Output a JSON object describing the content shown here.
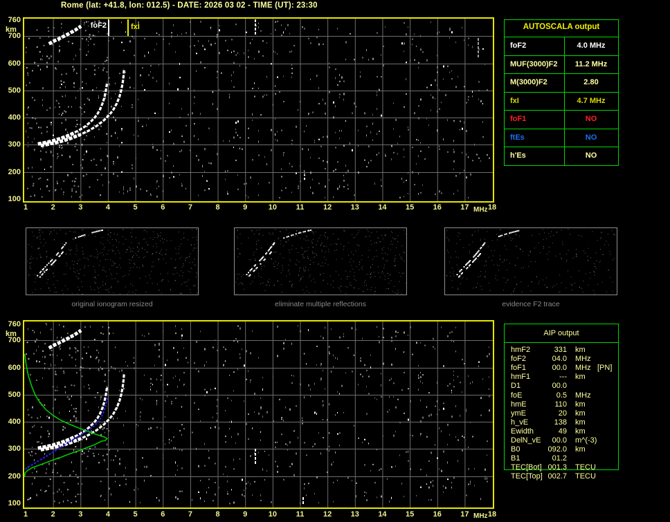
{
  "title": "Rome (lat: +41.8, lon: 012.5) - DATE: 2026 03 02 - TIME (UT): 23:30",
  "colors": {
    "pale_yellow": "#ffff9e",
    "bright_yellow": "#f0f000",
    "value_yellow": "#d8d800",
    "white": "#ffffff",
    "red": "#ff2020",
    "blue": "#1a70f0",
    "table_green": "#00d800",
    "axis_border_yellow": "#e8e800",
    "grid_gray": "#6e6e6e",
    "caption_gray": "#8a8a8a",
    "profile_green": "#00c800",
    "restored_blue": "#2222dd"
  },
  "autoscala_table": {
    "header": "AUTOSCALA output",
    "rows": [
      {
        "label": "foF2",
        "value": "4.0 MHz",
        "color": "#ffffff"
      },
      {
        "label": "MUF(3000)F2",
        "value": "11.2 MHz",
        "color": "#ffff9e"
      },
      {
        "label": "M(3000)F2",
        "value": "2.80",
        "color": "#ffff9e"
      },
      {
        "label": "fxI",
        "value": "4.7 MHz",
        "color": "#d8d800"
      },
      {
        "label": "foF1",
        "value": "NO",
        "color": "#ff2020"
      },
      {
        "label": "ftEs",
        "value": "NO",
        "color": "#1a70f0"
      },
      {
        "label": "h'Es",
        "value": "NO",
        "color": "#ffff9e"
      }
    ]
  },
  "aip_table": {
    "header": "AIP output",
    "rows": [
      {
        "label": "hmF2",
        "value": "331",
        "unit": "km",
        "note": ""
      },
      {
        "label": "foF2",
        "value": "04.0",
        "unit": "MHz",
        "note": ""
      },
      {
        "label": "foF1",
        "value": "00.0",
        "unit": "MHz",
        "note": "[PN]"
      },
      {
        "label": "hmF1",
        "value": "---",
        "unit": "km",
        "note": ""
      },
      {
        "label": "D1",
        "value": "00.0",
        "unit": "",
        "note": ""
      },
      {
        "label": "foE",
        "value": "0.5",
        "unit": "MHz",
        "note": ""
      },
      {
        "label": "hmE",
        "value": "110",
        "unit": "km",
        "note": ""
      },
      {
        "label": "ymE",
        "value": "20",
        "unit": "km",
        "note": ""
      },
      {
        "label": "h_vE",
        "value": "138",
        "unit": "km",
        "note": ""
      },
      {
        "label": "Ewidth",
        "value": "49",
        "unit": "km",
        "note": ""
      },
      {
        "label": "DelN_vE",
        "value": "00.0",
        "unit": "m^(-3)",
        "note": ""
      },
      {
        "label": "B0",
        "value": "092.0",
        "unit": "km",
        "note": ""
      },
      {
        "label": "B1",
        "value": "01.2",
        "unit": "",
        "note": ""
      },
      {
        "label": "TEC[Bot]",
        "value": "001.3",
        "unit": "TECU",
        "note": ""
      },
      {
        "label": "TEC[Top]",
        "value": "002.7",
        "unit": "TECU",
        "note": ""
      }
    ]
  },
  "thumbnails": [
    {
      "caption": "original ionogram resized"
    },
    {
      "caption": "eliminate multiple reflections"
    },
    {
      "caption": "evidence F2 trace"
    }
  ],
  "chart_data": [
    {
      "type": "scatter",
      "title": "autoscaled ionogram",
      "xlabel": "MHz",
      "ylabel": "km",
      "xlim": [
        1,
        18
      ],
      "ylim": [
        100,
        760
      ],
      "grid": true,
      "x_ticks": [
        1,
        2,
        3,
        4,
        5,
        6,
        7,
        8,
        9,
        10,
        11,
        12,
        13,
        14,
        15,
        16,
        17,
        18
      ],
      "y_ticks": [
        760,
        700,
        600,
        500,
        400,
        300,
        200,
        100
      ],
      "markers": [
        {
          "label": "foF2",
          "freq_mhz": 4.0,
          "color": "#ffffff"
        },
        {
          "label": "fxI",
          "freq_mhz": 4.7,
          "color": "#f0f000"
        }
      ],
      "series": [
        {
          "name": "F2 ordinary trace",
          "color": "#ffffff",
          "points": [
            [
              1.45,
              303
            ],
            [
              1.6,
              306
            ],
            [
              1.8,
              310
            ],
            [
              2.0,
              315
            ],
            [
              2.2,
              321
            ],
            [
              2.4,
              328
            ],
            [
              2.6,
              336
            ],
            [
              2.8,
              346
            ],
            [
              3.0,
              357
            ],
            [
              3.2,
              370
            ],
            [
              3.35,
              383
            ],
            [
              3.5,
              398
            ],
            [
              3.62,
              414
            ],
            [
              3.72,
              432
            ],
            [
              3.8,
              452
            ],
            [
              3.87,
              474
            ],
            [
              3.92,
              498
            ],
            [
              3.95,
              516
            ],
            [
              3.97,
              531
            ]
          ]
        },
        {
          "name": "F2 extraordinary trace",
          "color": "#ffffff",
          "points": [
            [
              1.55,
              297
            ],
            [
              1.8,
              302
            ],
            [
              2.1,
              308
            ],
            [
              2.4,
              316
            ],
            [
              2.7,
              326
            ],
            [
              3.0,
              338
            ],
            [
              3.3,
              352
            ],
            [
              3.6,
              370
            ],
            [
              3.85,
              390
            ],
            [
              4.05,
              410
            ],
            [
              4.2,
              430
            ],
            [
              4.32,
              452
            ],
            [
              4.42,
              477
            ],
            [
              4.49,
              503
            ],
            [
              4.54,
              530
            ],
            [
              4.57,
              556
            ],
            [
              4.59,
              580
            ]
          ]
        },
        {
          "name": "second-hop multiple",
          "color": "#ffffff",
          "points": [
            [
              1.85,
              672
            ],
            [
              2.05,
              683
            ],
            [
              2.3,
              695
            ],
            [
              2.55,
              708
            ],
            [
              2.8,
              722
            ],
            [
              3.02,
              737
            ]
          ]
        }
      ]
    },
    {
      "type": "scatter",
      "title": "ionogram with restored trace and electron density profile",
      "xlabel": "MHz",
      "ylabel": "km",
      "xlim": [
        1,
        18
      ],
      "ylim": [
        100,
        760
      ],
      "grid": true,
      "x_ticks": [
        1,
        2,
        3,
        4,
        5,
        6,
        7,
        8,
        9,
        10,
        11,
        12,
        13,
        14,
        15,
        16,
        17,
        18
      ],
      "y_ticks": [
        760,
        700,
        600,
        500,
        400,
        300,
        200,
        100
      ],
      "markers": [],
      "series": [
        {
          "name": "F2 ordinary trace",
          "color": "#ffffff",
          "points": [
            [
              1.45,
              303
            ],
            [
              1.6,
              306
            ],
            [
              1.8,
              310
            ],
            [
              2.0,
              315
            ],
            [
              2.2,
              321
            ],
            [
              2.4,
              328
            ],
            [
              2.6,
              336
            ],
            [
              2.8,
              346
            ],
            [
              3.0,
              357
            ],
            [
              3.2,
              370
            ],
            [
              3.35,
              383
            ],
            [
              3.5,
              398
            ],
            [
              3.62,
              414
            ],
            [
              3.72,
              432
            ],
            [
              3.8,
              452
            ],
            [
              3.87,
              474
            ],
            [
              3.92,
              498
            ],
            [
              3.95,
              516
            ],
            [
              3.97,
              531
            ]
          ]
        },
        {
          "name": "F2 extraordinary trace",
          "color": "#ffffff",
          "points": [
            [
              1.55,
              297
            ],
            [
              1.8,
              302
            ],
            [
              2.1,
              308
            ],
            [
              2.4,
              316
            ],
            [
              2.7,
              326
            ],
            [
              3.0,
              338
            ],
            [
              3.3,
              352
            ],
            [
              3.6,
              370
            ],
            [
              3.85,
              390
            ],
            [
              4.05,
              410
            ],
            [
              4.2,
              430
            ],
            [
              4.32,
              452
            ],
            [
              4.42,
              477
            ],
            [
              4.49,
              503
            ],
            [
              4.54,
              530
            ],
            [
              4.57,
              556
            ],
            [
              4.59,
              580
            ]
          ]
        },
        {
          "name": "second-hop multiple",
          "color": "#ffffff",
          "points": [
            [
              1.85,
              672
            ],
            [
              2.05,
              683
            ],
            [
              2.3,
              695
            ],
            [
              2.55,
              708
            ],
            [
              2.8,
              722
            ],
            [
              3.02,
              737
            ]
          ]
        },
        {
          "name": "electron density profile",
          "color": "#00c800",
          "points": [
            [
              0.97,
              650
            ],
            [
              1.02,
              610
            ],
            [
              1.1,
              570
            ],
            [
              1.22,
              532
            ],
            [
              1.36,
              497
            ],
            [
              1.53,
              470
            ],
            [
              1.74,
              445
            ],
            [
              2.0,
              424
            ],
            [
              2.28,
              406
            ],
            [
              2.58,
              392
            ],
            [
              2.92,
              378
            ],
            [
              3.27,
              365
            ],
            [
              3.6,
              353
            ],
            [
              3.85,
              345
            ],
            [
              3.97,
              339
            ],
            [
              3.9,
              331
            ],
            [
              3.77,
              329
            ],
            [
              3.51,
              316
            ],
            [
              3.26,
              306
            ],
            [
              3.01,
              296
            ],
            [
              2.76,
              288
            ],
            [
              2.5,
              278
            ],
            [
              2.25,
              268
            ],
            [
              2.0,
              260
            ],
            [
              1.75,
              250
            ],
            [
              1.5,
              241
            ],
            [
              1.24,
              231
            ],
            [
              1.08,
              222
            ],
            [
              0.98,
              212
            ],
            [
              0.97,
              199
            ]
          ]
        },
        {
          "name": "restored ordinary trace",
          "color": "#2222dd",
          "points": [
            [
              0.99,
              226
            ],
            [
              1.1,
              234
            ],
            [
              1.3,
              246
            ],
            [
              1.5,
              258
            ],
            [
              1.7,
              270
            ],
            [
              1.9,
              282
            ],
            [
              2.1,
              295
            ],
            [
              2.3,
              308
            ],
            [
              2.5,
              320
            ],
            [
              2.7,
              333
            ],
            [
              2.9,
              345
            ],
            [
              3.1,
              358
            ],
            [
              3.3,
              370
            ],
            [
              3.5,
              386
            ],
            [
              3.68,
              403
            ],
            [
              3.83,
              433
            ],
            [
              3.93,
              464
            ],
            [
              3.98,
              489
            ]
          ]
        }
      ]
    }
  ]
}
